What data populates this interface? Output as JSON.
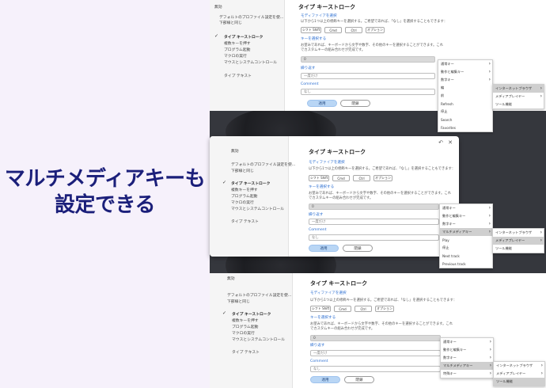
{
  "headline": {
    "line1": "マルチメディアキーも",
    "line2": "設定できる"
  },
  "sidebar": {
    "label_top": "無効",
    "default_profile": "デフォルトのプロファイル設定を使...",
    "hotkey": "下部線と同じ",
    "keystroke": "タイプ キーストローク",
    "items": [
      "複数キーを押す",
      "プログラム起動",
      "マクロの実行",
      "マウスとシステムコントロール"
    ],
    "type_text": "タイプ テキスト"
  },
  "panel": {
    "title": "タイプ キーストローク",
    "modifier_title": "モディファイアを選択",
    "modifier_desc": "以下から1つ以上の修飾キーを選択する。ご希望であれば、「なし」を選択することもできます：",
    "modifiers": [
      "シフト Shift",
      "Cmd",
      "Ctrl",
      "オプション"
    ],
    "key_title": "キーを選択する",
    "key_desc1": "お望みであれば、キーボードから文字や数字、その他のキーを選択することができます。これ",
    "key_desc2": "でカスタムキーの組み合わせが完成です。",
    "key_value": "0",
    "repeat_title": "繰り返す",
    "repeat_value": "一度だけ",
    "comment_title": "Comment",
    "comment_placeholder": "なし",
    "apply": "適用",
    "cancel": "閉鎖"
  },
  "menus": {
    "top_main": [
      "通常キー",
      "動作と編集キー",
      "数字キー",
      "編",
      "前",
      "Refresh",
      "停止",
      "Search",
      "Favorites"
    ],
    "top_sub": [
      "インターネットブラウザ",
      "メディアプレイヤー",
      "ツール機能"
    ],
    "mid_main": [
      "通常キー",
      "動作と編集キー",
      "数字キー",
      "マルチメディアキー",
      "Play",
      "停止",
      "Next track",
      "Previous track"
    ],
    "mid_sub": [
      "インターネットブラウザ",
      "メディアプレイヤー",
      "ツール機能"
    ],
    "bot_main": [
      "通常キー",
      "動作と編集キー",
      "数字キー",
      "マルチメディアキー",
      "特殊キー"
    ],
    "bot_sub": [
      "インターネットブラウザ",
      "メディアプレイヤー",
      "ツール機能"
    ]
  },
  "colors": {
    "accent": "#2d6fd1",
    "headline": "#1b1f7a",
    "primary_btn": "#b9d6f5"
  },
  "icons": {
    "back": "back-icon",
    "close": "close-icon",
    "check": "check-icon",
    "chevron": "chevron-right-icon"
  }
}
